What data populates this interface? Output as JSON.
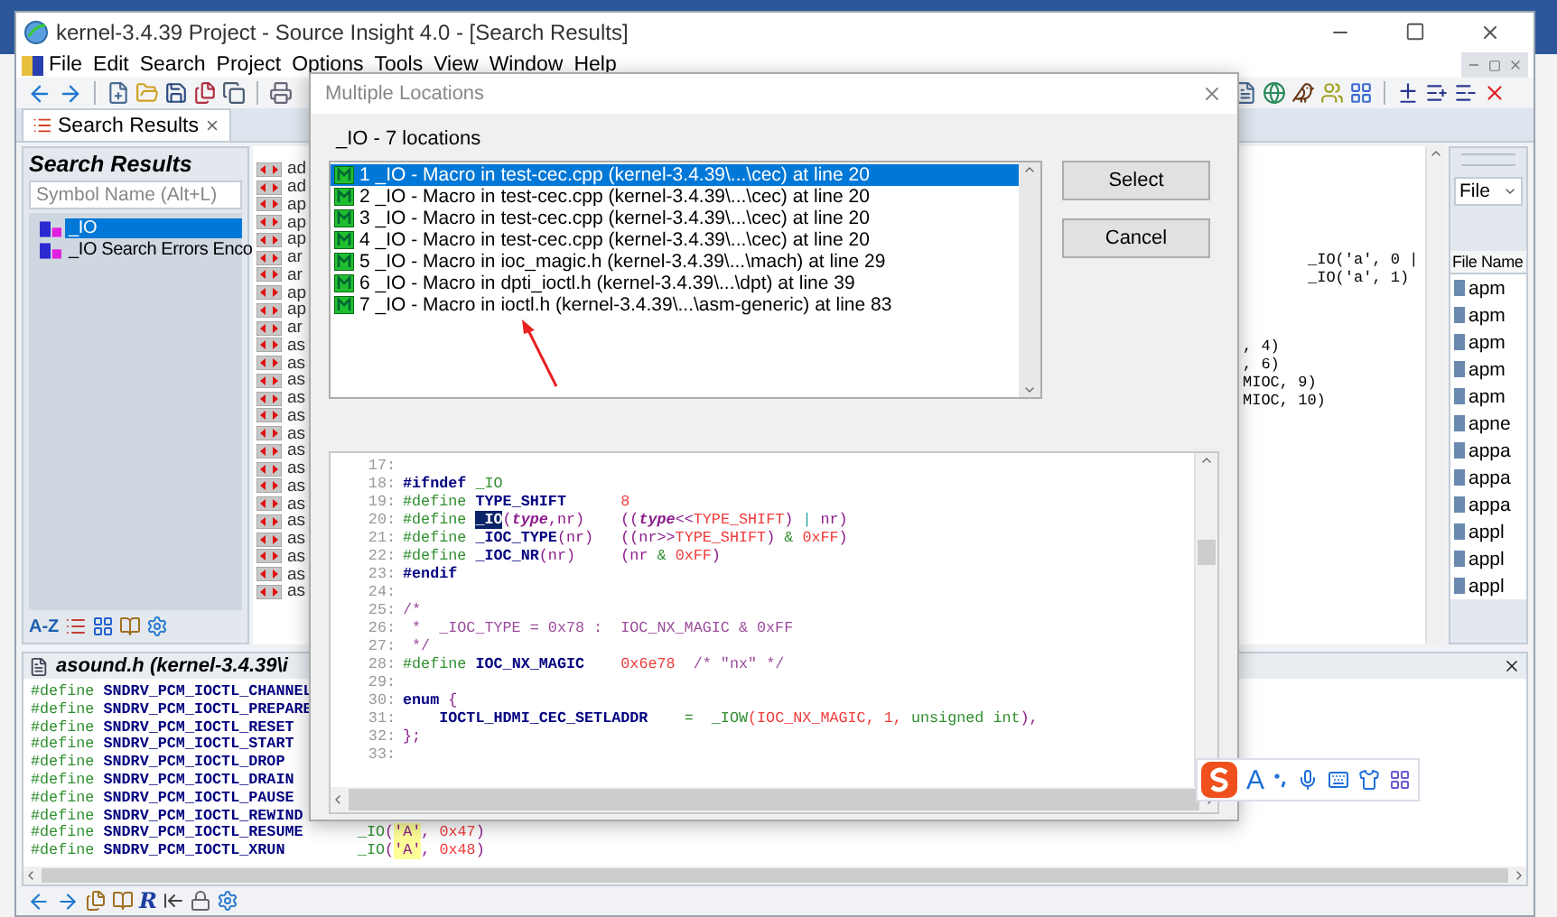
{
  "window": {
    "title": "kernel-3.4.39 Project - Source Insight 4.0 - [Search Results]"
  },
  "menu": [
    "File",
    "Edit",
    "Search",
    "Project",
    "Options",
    "Tools",
    "View",
    "Window",
    "Help"
  ],
  "tab": {
    "label": "Search Results",
    "selected": true
  },
  "search_panel": {
    "title": "Search Results",
    "placeholder": "Symbol Name (Alt+L)",
    "sort_label": "A-Z",
    "tree": [
      {
        "label": "_IO",
        "selected": true
      },
      {
        "label": "_IO Search Errors Enco",
        "selected": false
      }
    ]
  },
  "reference_rows": [
    "ad",
    "ad",
    "ap",
    "ap",
    "ap",
    "ar",
    "ar",
    "ap",
    "ap",
    "ar",
    "as",
    "as",
    "as",
    "as",
    "as",
    "as",
    "as",
    "as",
    "as",
    "as",
    "as",
    "as",
    "as",
    "as",
    "as"
  ],
  "editor_lines": [
    {
      "text": "_IO('a', 0 |",
      "kind": "far"
    },
    {
      "text": "_IO('a', 1)",
      "kind": "far"
    },
    {
      "text": ", 4)",
      "kind": "near"
    },
    {
      "text": ", 6)",
      "kind": "near"
    },
    {
      "text": "MIOC, 9)",
      "kind": "near"
    },
    {
      "text": "MIOC, 10)",
      "kind": "near"
    }
  ],
  "file_panel": {
    "filter": "File",
    "column": "File Name",
    "files": [
      "apm",
      "apm",
      "apm",
      "apm",
      "apm",
      "apne",
      "appa",
      "appa",
      "appa",
      "appl",
      "appl",
      "appl"
    ]
  },
  "source_pane": {
    "title": "asound.h (kernel-3.4.39\\i",
    "lines": [
      [
        {
          "kind": "pp",
          "text": "#define "
        },
        {
          "kind": "kw",
          "text": "SNDRV_PCM_IOCTL_CHANNEL"
        }
      ],
      [
        {
          "kind": "pp",
          "text": "#define "
        },
        {
          "kind": "kw",
          "text": "SNDRV_PCM_IOCTL_PREPARE"
        }
      ],
      [
        {
          "kind": "pp",
          "text": "#define "
        },
        {
          "kind": "kw",
          "text": "SNDRV_PCM_IOCTL_RESET"
        }
      ],
      [
        {
          "kind": "pp",
          "text": "#define "
        },
        {
          "kind": "kw",
          "text": "SNDRV_PCM_IOCTL_START"
        }
      ],
      [
        {
          "kind": "pp",
          "text": "#define "
        },
        {
          "kind": "kw",
          "text": "SNDRV_PCM_IOCTL_DROP"
        }
      ],
      [
        {
          "kind": "pp",
          "text": "#define "
        },
        {
          "kind": "kw",
          "text": "SNDRV_PCM_IOCTL_DRAIN"
        }
      ],
      [
        {
          "kind": "pp",
          "text": "#define "
        },
        {
          "kind": "kw",
          "text": "SNDRV_PCM_IOCTL_PAUSE"
        }
      ],
      [
        {
          "kind": "pp",
          "text": "#define "
        },
        {
          "kind": "kw",
          "text": "SNDRV_PCM_IOCTL_REWIND"
        }
      ],
      [
        {
          "kind": "pp",
          "text": "#define "
        },
        {
          "kind": "kw",
          "text": "SNDRV_PCM_IOCTL_RESUME      "
        },
        {
          "kind": "pp",
          "text": "_IO"
        },
        {
          "kind": "op",
          "text": "("
        },
        {
          "kind": "str",
          "text": "'A'"
        },
        {
          "kind": "op",
          "text": ", "
        },
        {
          "kind": "num",
          "text": "0x47"
        },
        {
          "kind": "op",
          "text": ")"
        }
      ],
      [
        {
          "kind": "pp",
          "text": "#define "
        },
        {
          "kind": "kw",
          "text": "SNDRV_PCM_IOCTL_XRUN        "
        },
        {
          "kind": "pp",
          "text": "_IO"
        },
        {
          "kind": "op",
          "text": "("
        },
        {
          "kind": "str",
          "text": "'A'"
        },
        {
          "kind": "op",
          "text": ", "
        },
        {
          "kind": "num",
          "text": "0x48"
        },
        {
          "kind": "op",
          "text": ")"
        }
      ]
    ]
  },
  "bottom_toolbar": {
    "r_label": "R"
  },
  "dialog": {
    "title": "Multiple Locations",
    "summary": "_IO - 7 locations",
    "buttons": [
      "Select",
      "Cancel"
    ],
    "locations": [
      {
        "label": "1 _IO - Macro in test-cec.cpp (kernel-3.4.39\\...\\cec) at line 20",
        "selected": true
      },
      {
        "label": "2 _IO - Macro in test-cec.cpp (kernel-3.4.39\\...\\cec) at line 20",
        "selected": false
      },
      {
        "label": "3 _IO - Macro in test-cec.cpp (kernel-3.4.39\\...\\cec) at line 20",
        "selected": false
      },
      {
        "label": "4 _IO - Macro in test-cec.cpp (kernel-3.4.39\\...\\cec) at line 20",
        "selected": false
      },
      {
        "label": "5 _IO - Macro in ioc_magic.h (kernel-3.4.39\\...\\mach) at line 29",
        "selected": false
      },
      {
        "label": "6 _IO - Macro in dpti_ioctl.h (kernel-3.4.39\\...\\dpt) at line 39",
        "selected": false
      },
      {
        "label": "7 _IO - Macro in ioctl.h (kernel-3.4.39\\...\\asm-generic) at line 83",
        "selected": false
      }
    ],
    "preview": [
      {
        "no": "17:"
      },
      {
        "no": "18:",
        "tokens": [
          {
            "kind": "kw",
            "text": "#ifndef "
          },
          {
            "kind": "pp",
            "text": "_IO"
          }
        ]
      },
      {
        "no": "19:",
        "tokens": [
          {
            "kind": "pp",
            "text": "#define "
          },
          {
            "kind": "kw",
            "text": "TYPE_SHIFT      "
          },
          {
            "kind": "num",
            "text": "8"
          }
        ]
      },
      {
        "no": "20:",
        "tokens": [
          {
            "kind": "pp",
            "text": "#define "
          },
          {
            "kind": "hl",
            "text": "_IO"
          },
          {
            "kind": "op",
            "text": "("
          },
          {
            "kind": "par",
            "text": "type"
          },
          {
            "kind": "op",
            "text": ",nr)    (("
          },
          {
            "kind": "par",
            "text": "type"
          },
          {
            "kind": "op",
            "text": "<<"
          },
          {
            "kind": "num",
            "text": "TYPE_SHIFT"
          },
          {
            "kind": "op",
            "text": ") "
          },
          {
            "kind": "bar",
            "text": "|"
          },
          {
            "kind": "op",
            "text": " nr)"
          }
        ]
      },
      {
        "no": "21:",
        "tokens": [
          {
            "kind": "pp",
            "text": "#define "
          },
          {
            "kind": "kw",
            "text": "_IOC_TYPE"
          },
          {
            "kind": "op",
            "text": "(nr)   ((nr>>"
          },
          {
            "kind": "num",
            "text": "TYPE_SHIFT"
          },
          {
            "kind": "op",
            "text": ") "
          },
          {
            "kind": "pp",
            "text": "& "
          },
          {
            "kind": "num",
            "text": "0xFF"
          },
          {
            "kind": "op",
            "text": ")"
          }
        ]
      },
      {
        "no": "22:",
        "tokens": [
          {
            "kind": "pp",
            "text": "#define "
          },
          {
            "kind": "kw",
            "text": "_IOC_NR"
          },
          {
            "kind": "op",
            "text": "(nr)     (nr "
          },
          {
            "kind": "pp",
            "text": "& "
          },
          {
            "kind": "num",
            "text": "0xFF"
          },
          {
            "kind": "op",
            "text": ")"
          }
        ]
      },
      {
        "no": "23:",
        "tokens": [
          {
            "kind": "kw",
            "text": "#endif"
          }
        ]
      },
      {
        "no": "24:"
      },
      {
        "no": "25:",
        "tokens": [
          {
            "kind": "cm",
            "text": "/*"
          }
        ]
      },
      {
        "no": "26:",
        "tokens": [
          {
            "kind": "cm",
            "text": " *  _IOC_TYPE = 0x78 :  IOC_NX_MAGIC & 0xFF"
          }
        ]
      },
      {
        "no": "27:",
        "tokens": [
          {
            "kind": "cm",
            "text": " */"
          }
        ]
      },
      {
        "no": "28:",
        "tokens": [
          {
            "kind": "pp",
            "text": "#define "
          },
          {
            "kind": "kw",
            "text": "IOC_NX_MAGIC    "
          },
          {
            "kind": "num",
            "text": "0x6e78  "
          },
          {
            "kind": "cm",
            "text": "/* \"nx\" */"
          }
        ]
      },
      {
        "no": "29:"
      },
      {
        "no": "30:",
        "tokens": [
          {
            "kind": "kw",
            "text": "enum "
          },
          {
            "kind": "op",
            "text": "{"
          }
        ]
      },
      {
        "no": "31:",
        "tokens": [
          {
            "kind": "kw",
            "text": "    IOCTL_HDMI_CEC_SETLADDR    "
          },
          {
            "kind": "pp",
            "text": "=  _IOW"
          },
          {
            "kind": "num",
            "text": "(IOC_NX_MAGIC, 1, "
          },
          {
            "kind": "pp",
            "text": "unsigned int"
          },
          {
            "kind": "op",
            "text": "),"
          }
        ]
      },
      {
        "no": "32:",
        "tokens": [
          {
            "kind": "op",
            "text": "};"
          }
        ]
      },
      {
        "no": "33:"
      }
    ]
  },
  "ime_bar": {
    "letter": "A"
  }
}
